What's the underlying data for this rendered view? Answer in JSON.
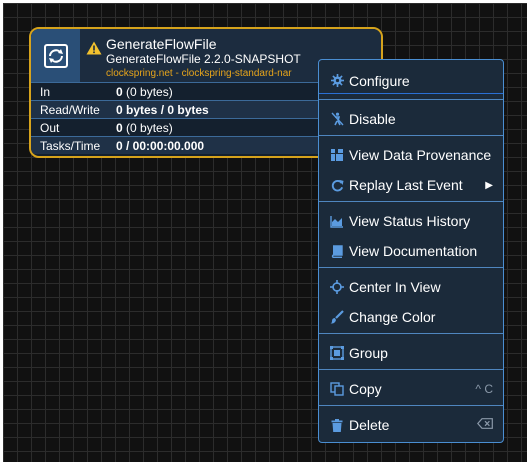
{
  "processor": {
    "name": "GenerateFlowFile",
    "type": "GenerateFlowFile 2.2.0-SNAPSHOT",
    "bundle": "clockspring.net - clockspring-standard-nar",
    "stats": [
      {
        "label": "In",
        "value_bold": "0",
        "value_rest": " (0 bytes)"
      },
      {
        "label": "Read/Write",
        "value_bold": "0 bytes / 0 bytes",
        "value_rest": ""
      },
      {
        "label": "Out",
        "value_bold": "0",
        "value_rest": " (0 bytes)"
      },
      {
        "label": "Tasks/Time",
        "value_bold": "0 / 00:00:00.000",
        "value_rest": ""
      }
    ]
  },
  "menu": {
    "configure": "Configure",
    "disable": "Disable",
    "view_provenance": "View Data Provenance",
    "replay_last_event": "Replay Last Event",
    "view_status_history": "View Status History",
    "view_documentation": "View Documentation",
    "center_in_view": "Center In View",
    "change_color": "Change Color",
    "group": "Group",
    "copy": "Copy",
    "copy_shortcut": "^ C",
    "delete": "Delete"
  },
  "colors": {
    "accent": "#4a8ed2",
    "warning": "#f2c12e",
    "bundle_text": "#e7a51b",
    "card_border": "#d6a31c"
  },
  "icons": {
    "processor": "processor-icon",
    "warning": "warning-icon",
    "configure": "gear-icon",
    "disable": "disable-icon",
    "provenance": "provenance-icon",
    "replay": "replay-icon",
    "status_history": "area-chart-icon",
    "documentation": "book-icon",
    "center": "crosshair-icon",
    "color": "paintbrush-icon",
    "group": "group-icon",
    "copy": "copy-icon",
    "delete": "trash-icon",
    "backspace": "backspace-icon"
  }
}
